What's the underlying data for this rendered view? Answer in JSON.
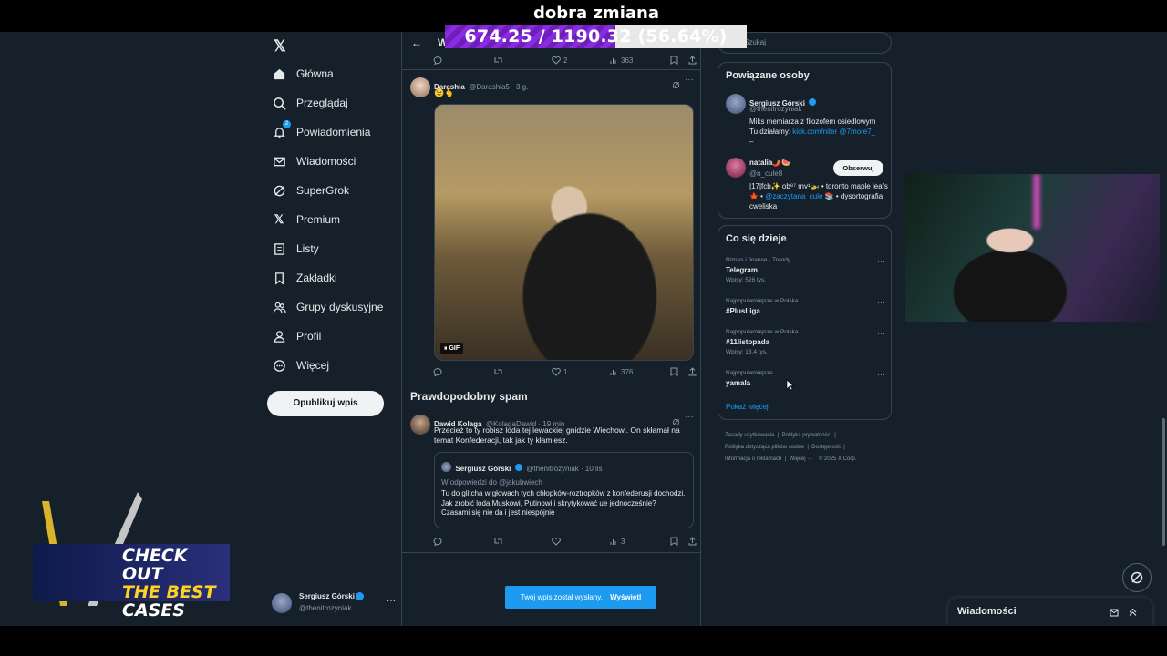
{
  "overlay": {
    "title": "dobra zmiana",
    "progress_text": "674.25 / 1190.32 (56.64%)",
    "progress_fraction": 0.5664,
    "promo_line1": "CHECK OUT",
    "promo_line2": "THE BEST",
    "promo_line3": "CASES"
  },
  "nav": {
    "logo": "𝕏",
    "items": [
      {
        "label": "Główna"
      },
      {
        "label": "Przeglądaj"
      },
      {
        "label": "Powiadomienia",
        "badge": "2"
      },
      {
        "label": "Wiadomości"
      },
      {
        "label": "SuperGrok"
      },
      {
        "label": "Premium"
      },
      {
        "label": "Listy"
      },
      {
        "label": "Zakładki"
      },
      {
        "label": "Grupy dyskusyjne"
      },
      {
        "label": "Profil"
      },
      {
        "label": "Więcej"
      }
    ],
    "post_button": "Opublikuj wpis",
    "account_name": "Sergiusz Górski",
    "account_handle": "@thenitrozyniak",
    "account_more": "···"
  },
  "main": {
    "back": "←",
    "header_title": "W",
    "top_actions": {
      "reply": "",
      "retweet": "",
      "likes": "2",
      "views": "363"
    },
    "tweet1": {
      "name": "Darashia",
      "handle": "@Darashia5 · 3 g.",
      "text": "😉🫰",
      "gif_label": "GIF",
      "likes": "1",
      "views": "376"
    },
    "section_title": "Prawdopodobny spam",
    "tweet2": {
      "name": "Dawid Kolaga",
      "handle": "@KolagaDawid · 19 min",
      "text": "Przecież to ty robisz loda tej lewackiej gnidzie Wiechowi. On skłamał na temat Konfederacji, tak jak ty kłamiesz.",
      "quote_name": "Sergiusz Górski",
      "quote_handle": "@thenitrozyniak · 10 lis",
      "quote_reply_to": "W odpowiedzi do @jakubwiech",
      "quote_text": "Tu do glitcha w głowach tych chłopków-roztropków z konfederusji dochodzi. Jak zrobić loda Muskowi, Putinowi i skrytykować ue jednocześnie?",
      "quote_text2": "Czasami się nie da i jest niespójnie",
      "views": "3"
    },
    "toast": "Twój wpis został wysłany.",
    "toast_action": "Wyświetl"
  },
  "right": {
    "search_placeholder": "Szukaj",
    "related_title": "Powiązane osoby",
    "people": [
      {
        "name": "Sergiusz Górski",
        "handle": "@thenitrozyniak",
        "bio": "Miks memiarza z filozofem osiedlowym",
        "bio2": "Tu działamy: ",
        "bio_links": "kick.com/niter @7more7_",
        "bio3": "–"
      },
      {
        "name": "natalia🌶️🍉",
        "handle": "@n_cule8",
        "bio": "|17|fcb✨ ob⁸⁷ mv¹🚁 • toronto maple leafs 🍁 • ",
        "bio_link": "@zaczytana_cule",
        "bio2": " 📚 • dysortografia cweliska",
        "follow": "Obserwuj"
      }
    ],
    "trends_title": "Co się dzieje",
    "trends": [
      {
        "category": "Biznes i finanse · Trendy",
        "title": "Telegram",
        "count": "Wpisy: 526 tys."
      },
      {
        "category": "Najpopularniejsze w Polska",
        "title": "#PlusLiga",
        "count": ""
      },
      {
        "category": "Najpopularniejsze w Polska",
        "title": "#11listopada",
        "count": "Wpisy: 13,4 tys."
      },
      {
        "category": "Najpopularniejsze",
        "title": "yamala",
        "count": ""
      }
    ],
    "show_more": "Pokaż więcej",
    "footer": [
      "Zasady użytkowania",
      "Polityka prywatności",
      "Polityka dotycząca plików cookie",
      "Dostępność",
      "Informacja o reklamach",
      "Więcej ···",
      "© 2025 X Corp."
    ],
    "messages_drawer": "Wiadomości"
  },
  "colors": {
    "background": "#15202b",
    "accent": "#1d9bf0",
    "border": "#38444d",
    "muted": "#8b98a5"
  }
}
